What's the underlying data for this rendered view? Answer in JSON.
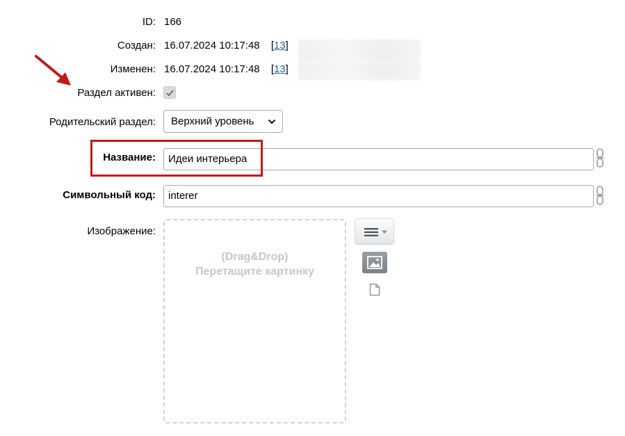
{
  "fields": {
    "id": {
      "label": "ID:",
      "value": "166"
    },
    "created": {
      "label": "Создан:",
      "value": "16.07.2024 10:17:48",
      "bracket_open": "[",
      "user_id": "13",
      "bracket_close": "]"
    },
    "modified": {
      "label": "Изменен:",
      "value": "16.07.2024 10:17:48",
      "bracket_open": "[",
      "user_id": "13",
      "bracket_close": "]"
    },
    "active": {
      "label": "Раздел активен:",
      "checked": true
    },
    "parent": {
      "label": "Родительский раздел:",
      "selected": "Верхний уровень"
    },
    "name": {
      "label": "Название:",
      "value": "Идеи интерьера"
    },
    "code": {
      "label": "Символьный код:",
      "value": "interer"
    },
    "image": {
      "label": "Изображение:",
      "drop_line1": "(Drag&Drop)",
      "drop_line2": "Перетащите картинку"
    }
  },
  "icons": {
    "menu": "menu-dropdown-icon",
    "image": "image-icon",
    "file": "file-icon",
    "chain": "chain-link-icon",
    "check": "checkmark-icon",
    "arrow": "annotation-arrow"
  },
  "colors": {
    "annotation": "#c11a1a",
    "link": "#2067b0"
  }
}
